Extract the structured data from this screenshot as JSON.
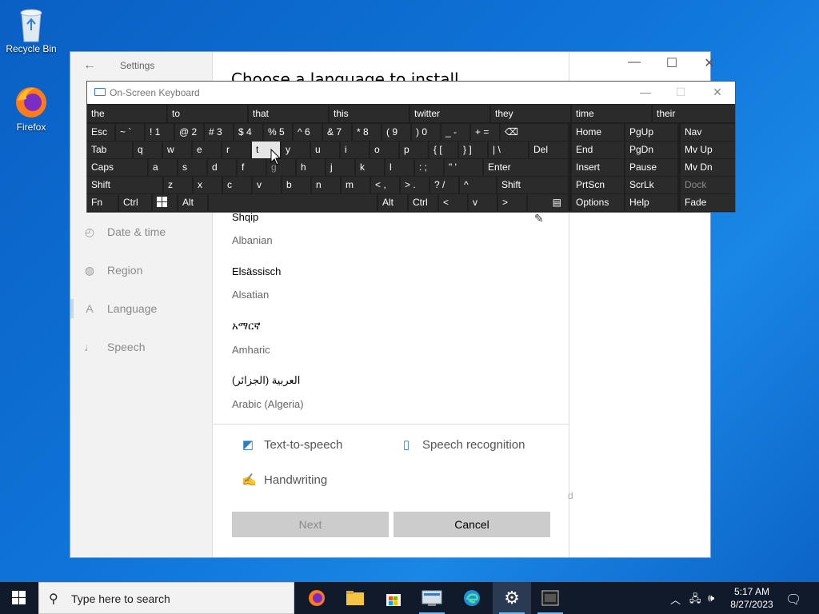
{
  "desktop": {
    "icons": [
      {
        "label": "Recycle Bin"
      },
      {
        "label": "Firefox"
      }
    ]
  },
  "settings": {
    "app_title": "Settings",
    "nav": [
      {
        "label": "Date & time",
        "icon": "clock-globe-icon"
      },
      {
        "label": "Region",
        "icon": "globe-icon"
      },
      {
        "label": "Language",
        "icon": "language-icon"
      },
      {
        "label": "Speech",
        "icon": "microphone-icon"
      }
    ],
    "dialog": {
      "heading": "Choose a language to install",
      "languages": [
        {
          "native": "Shqip",
          "english": "Albanian"
        },
        {
          "native": "Elsässisch",
          "english": "Alsatian"
        },
        {
          "native": "አማርኛ",
          "english": "Amharic"
        },
        {
          "native": "العربية (الجزائر)",
          "english": "Arabic (Algeria)"
        }
      ],
      "features": {
        "tts": "Text-to-speech",
        "speech_recognition": "Speech recognition",
        "handwriting": "Handwriting"
      },
      "next_label": "Next",
      "cancel_label": "Cancel"
    },
    "ghost_letter": "d"
  },
  "osk": {
    "title": "On-Screen Keyboard",
    "predictions": [
      "the",
      "to",
      "that",
      "this",
      "twitter",
      "they",
      "time",
      "their"
    ],
    "row1": {
      "esc": "Esc",
      "keys": [
        "~ `",
        "! 1",
        "@ 2",
        "# 3",
        "$ 4",
        "% 5",
        "^ 6",
        "& 7",
        "* 8",
        "( 9",
        ") 0",
        "_ -",
        "+ ="
      ],
      "backspace": "⌫"
    },
    "row2": {
      "tab": "Tab",
      "keys": [
        "q",
        "w",
        "e",
        "r",
        "t",
        "y",
        "u",
        "i",
        "o",
        "p"
      ],
      "brace_open": "{ [",
      "brace_close": "} ]",
      "pipe": "| \\",
      "del": "Del"
    },
    "row3": {
      "caps": "Caps",
      "keys": [
        "a",
        "s",
        "d",
        "f",
        "g",
        "h",
        "j",
        "k",
        "l"
      ],
      "colon": ": ;",
      "quote": "\" '",
      "enter": "Enter"
    },
    "row4": {
      "shift": "Shift",
      "keys": [
        "z",
        "x",
        "c",
        "v",
        "b",
        "n",
        "m"
      ],
      "lt": "< ,",
      "gt": "> .",
      "q": "? /",
      "up": "^",
      "shift_r": "Shift"
    },
    "row5": {
      "fn": "Fn",
      "ctrl": "Ctrl",
      "alt": "Alt",
      "alt_r": "Alt",
      "ctrl_r": "Ctrl",
      "left": "<",
      "down": "v",
      "right": ">"
    },
    "nav_keys": [
      [
        "Home",
        "PgUp",
        "Nav"
      ],
      [
        "End",
        "PgDn",
        "Mv Up"
      ],
      [
        "Insert",
        "Pause",
        "Mv Dn"
      ],
      [
        "PrtScn",
        "ScrLk",
        "Dock"
      ],
      [
        "Options",
        "Help",
        "Fade"
      ]
    ]
  },
  "taskbar": {
    "search_placeholder": "Type here to search",
    "time": "5:17 AM",
    "date": "8/27/2023"
  }
}
